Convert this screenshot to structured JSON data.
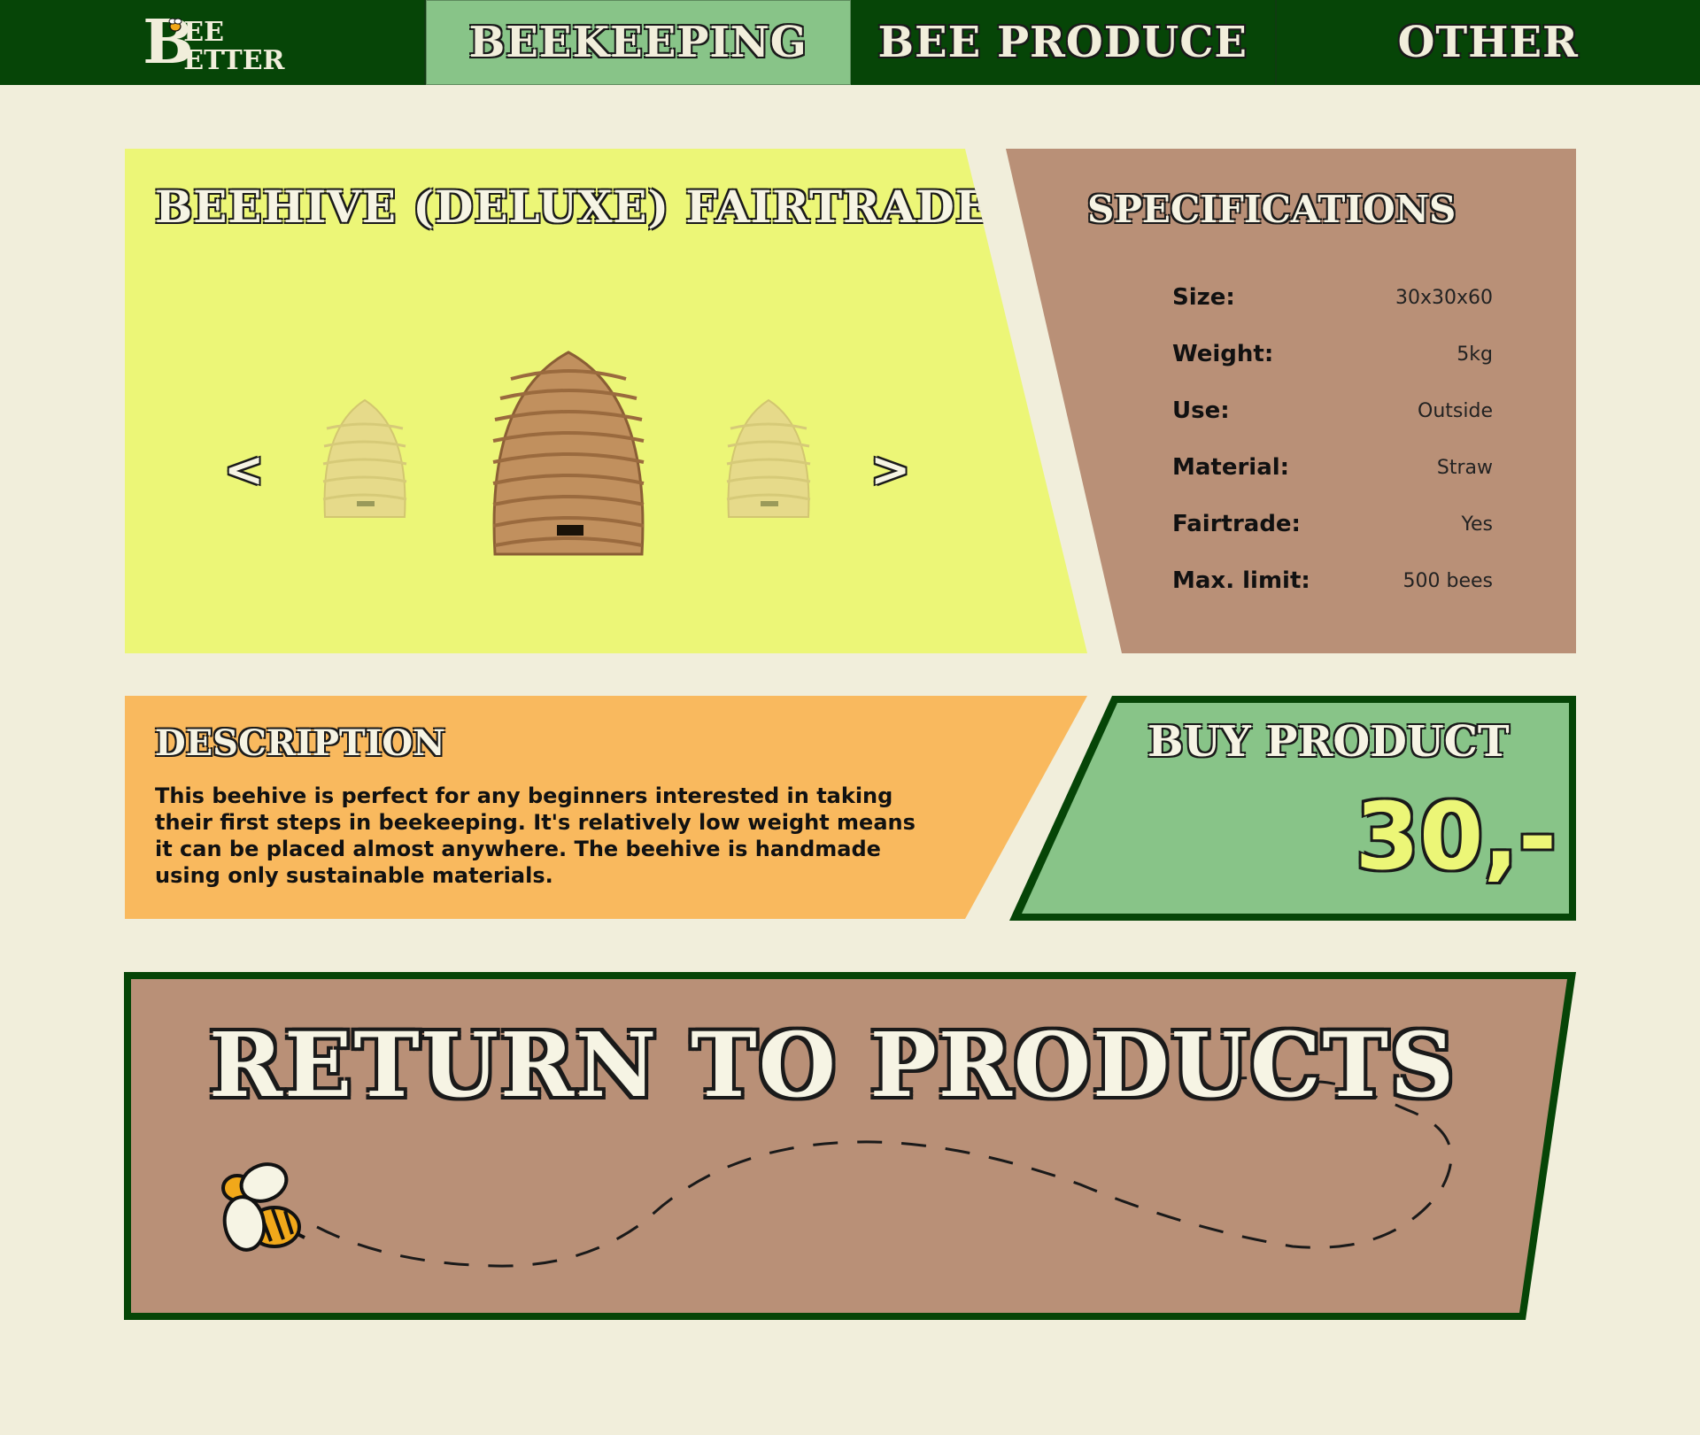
{
  "nav": {
    "logo_big": "B",
    "logo_top": "EE",
    "logo_bottom": "ETTER",
    "items": [
      {
        "label": "BEEKEEPING",
        "active": true
      },
      {
        "label": "BEE PRODUCE",
        "active": false
      },
      {
        "label": "OTHER",
        "active": false
      }
    ]
  },
  "product": {
    "title": "BEEHIVE (DELUXE) FAIRTRADE",
    "prev": "<",
    "next": ">"
  },
  "specs": {
    "title": "SPECIFICATIONS",
    "rows": [
      {
        "key": "Size:",
        "value": "30x30x60"
      },
      {
        "key": "Weight:",
        "value": "5kg"
      },
      {
        "key": "Use:",
        "value": "Outside"
      },
      {
        "key": "Material:",
        "value": "Straw"
      },
      {
        "key": "Fairtrade:",
        "value": "Yes"
      },
      {
        "key": "Max. limit:",
        "value": "500 bees"
      }
    ]
  },
  "description": {
    "title": "DESCRIPTION",
    "text": "This beehive is perfect for any beginners interested in taking their first steps in beekeeping. It's relatively low weight means it can be placed almost anywhere. The beehive is handmade using only sustainable materials."
  },
  "buy": {
    "title": "BUY PRODUCT",
    "price": "30,-"
  },
  "return": {
    "label": "RETURN TO PRODUCTS"
  },
  "colors": {
    "nav_bg": "#064507",
    "nav_active": "#88c488",
    "page_bg": "#f1eedb",
    "product_panel": "#ecf677",
    "spec_panel": "#b99077",
    "desc_panel": "#f9b95e",
    "buy_panel": "#88c488"
  }
}
